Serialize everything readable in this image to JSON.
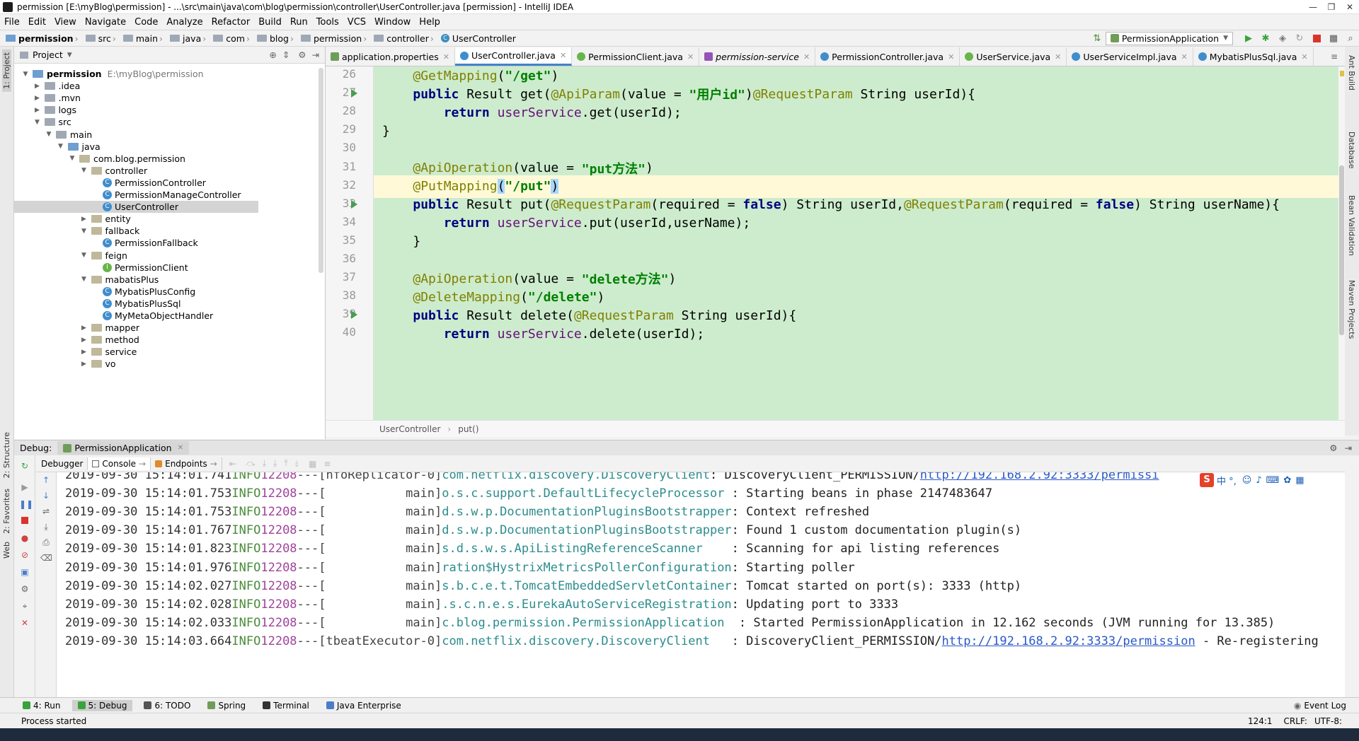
{
  "window": {
    "title": "permission [E:\\myBlog\\permission] - ...\\src\\main\\java\\com\\blog\\permission\\controller\\UserController.java [permission] - IntelliJ IDEA",
    "min": "—",
    "max": "❐",
    "close": "✕"
  },
  "menu": [
    "File",
    "Edit",
    "View",
    "Navigate",
    "Code",
    "Analyze",
    "Refactor",
    "Build",
    "Run",
    "Tools",
    "VCS",
    "Window",
    "Help"
  ],
  "breadcrumb": [
    "permission",
    "src",
    "main",
    "java",
    "com",
    "blog",
    "permission",
    "controller",
    "UserController"
  ],
  "run_config": "PermissionApplication",
  "project_panel": {
    "title": "Project",
    "items": [
      {
        "label": "permission",
        "path": "E:\\myBlog\\permission",
        "indent": 0,
        "expanded": true,
        "kind": "folder-blue"
      },
      {
        "label": ".idea",
        "indent": 1,
        "expanded": false,
        "kind": "folder"
      },
      {
        "label": ".mvn",
        "indent": 1,
        "expanded": false,
        "kind": "folder"
      },
      {
        "label": "logs",
        "indent": 1,
        "expanded": false,
        "kind": "folder"
      },
      {
        "label": "src",
        "indent": 1,
        "expanded": true,
        "kind": "folder"
      },
      {
        "label": "main",
        "indent": 2,
        "expanded": true,
        "kind": "folder"
      },
      {
        "label": "java",
        "indent": 3,
        "expanded": true,
        "kind": "folder-blue"
      },
      {
        "label": "com.blog.permission",
        "indent": 4,
        "expanded": true,
        "kind": "pkg"
      },
      {
        "label": "controller",
        "indent": 5,
        "expanded": true,
        "kind": "pkg"
      },
      {
        "label": "PermissionController",
        "indent": 6,
        "kind": "class"
      },
      {
        "label": "PermissionManageController",
        "indent": 6,
        "kind": "class"
      },
      {
        "label": "UserController",
        "indent": 6,
        "kind": "class",
        "selected": true
      },
      {
        "label": "entity",
        "indent": 5,
        "expanded": false,
        "kind": "pkg"
      },
      {
        "label": "fallback",
        "indent": 5,
        "expanded": true,
        "kind": "pkg"
      },
      {
        "label": "PermissionFallback",
        "indent": 6,
        "kind": "class"
      },
      {
        "label": "feign",
        "indent": 5,
        "expanded": true,
        "kind": "pkg"
      },
      {
        "label": "PermissionClient",
        "indent": 6,
        "kind": "interface"
      },
      {
        "label": "mabatisPlus",
        "indent": 5,
        "expanded": true,
        "kind": "pkg"
      },
      {
        "label": "MybatisPlusConfig",
        "indent": 6,
        "kind": "class"
      },
      {
        "label": "MybatisPlusSql",
        "indent": 6,
        "kind": "class"
      },
      {
        "label": "MyMetaObjectHandler",
        "indent": 6,
        "kind": "class"
      },
      {
        "label": "mapper",
        "indent": 5,
        "expanded": false,
        "kind": "pkg"
      },
      {
        "label": "method",
        "indent": 5,
        "expanded": false,
        "kind": "pkg"
      },
      {
        "label": "service",
        "indent": 5,
        "expanded": false,
        "kind": "pkg"
      },
      {
        "label": "vo",
        "indent": 5,
        "expanded": false,
        "kind": "pkg"
      }
    ]
  },
  "editor_tabs": [
    {
      "label": "application.properties",
      "icon": "p"
    },
    {
      "label": "UserController.java",
      "icon": "c",
      "active": true
    },
    {
      "label": "PermissionClient.java",
      "icon": "i"
    },
    {
      "label": "permission-service",
      "icon": "m"
    },
    {
      "label": "PermissionController.java",
      "icon": "c"
    },
    {
      "label": "UserService.java",
      "icon": "i"
    },
    {
      "label": "UserServiceImpl.java",
      "icon": "c"
    },
    {
      "label": "MybatisPlusSql.java",
      "icon": "c"
    }
  ],
  "code_lines": [
    {
      "n": "26",
      "segs": [
        [
          "    ",
          "plain"
        ],
        [
          "@GetMapping",
          "ann"
        ],
        [
          "(",
          "plain"
        ],
        [
          "\"/get\"",
          "str"
        ],
        [
          ")",
          "plain"
        ]
      ]
    },
    {
      "n": "27",
      "run": true,
      "segs": [
        [
          "    ",
          "plain"
        ],
        [
          "public ",
          "kw"
        ],
        [
          "Result get(",
          "plain"
        ],
        [
          "@ApiParam",
          "ann"
        ],
        [
          "(value = ",
          "plain"
        ],
        [
          "\"用户id\"",
          "str"
        ],
        [
          ")",
          "plain"
        ],
        [
          "@RequestParam",
          "ann"
        ],
        [
          " String userId){",
          "plain"
        ]
      ]
    },
    {
      "n": "28",
      "segs": [
        [
          "        ",
          "plain"
        ],
        [
          "return ",
          "kw"
        ],
        [
          "userService",
          "fld"
        ],
        [
          ".get(userId);",
          "plain"
        ]
      ]
    },
    {
      "n": "29",
      "segs": [
        [
          "}",
          "plain"
        ]
      ]
    },
    {
      "n": "30",
      "segs": [
        [
          "",
          "plain"
        ]
      ]
    },
    {
      "n": "31",
      "segs": [
        [
          "    ",
          "plain"
        ],
        [
          "@ApiOperation",
          "ann"
        ],
        [
          "(value = ",
          "plain"
        ],
        [
          "\"put方法\"",
          "str"
        ],
        [
          ")",
          "plain"
        ]
      ]
    },
    {
      "n": "32",
      "current": true,
      "segs": [
        [
          "    ",
          "plain"
        ],
        [
          "@PutMapping",
          "ann"
        ],
        [
          "(",
          "hl"
        ],
        [
          "\"/put\"",
          "str"
        ],
        [
          ")",
          "hl"
        ]
      ]
    },
    {
      "n": "33",
      "run": true,
      "segs": [
        [
          "    ",
          "plain"
        ],
        [
          "public ",
          "kw"
        ],
        [
          "Result put(",
          "plain"
        ],
        [
          "@RequestParam",
          "ann"
        ],
        [
          "(required = ",
          "plain"
        ],
        [
          "false",
          "kw"
        ],
        [
          ") String userId,",
          "plain"
        ],
        [
          "@RequestParam",
          "ann"
        ],
        [
          "(required = ",
          "plain"
        ],
        [
          "false",
          "kw"
        ],
        [
          ") String userName){",
          "plain"
        ]
      ]
    },
    {
      "n": "34",
      "segs": [
        [
          "        ",
          "plain"
        ],
        [
          "return ",
          "kw"
        ],
        [
          "userService",
          "fld"
        ],
        [
          ".put(userId,userName);",
          "plain"
        ]
      ]
    },
    {
      "n": "35",
      "segs": [
        [
          "    }",
          "plain"
        ]
      ]
    },
    {
      "n": "36",
      "segs": [
        [
          "",
          "plain"
        ]
      ]
    },
    {
      "n": "37",
      "segs": [
        [
          "    ",
          "plain"
        ],
        [
          "@ApiOperation",
          "ann"
        ],
        [
          "(value = ",
          "plain"
        ],
        [
          "\"delete方法\"",
          "str"
        ],
        [
          ")",
          "plain"
        ]
      ]
    },
    {
      "n": "38",
      "segs": [
        [
          "    ",
          "plain"
        ],
        [
          "@DeleteMapping",
          "ann"
        ],
        [
          "(",
          "plain"
        ],
        [
          "\"/delete\"",
          "str"
        ],
        [
          ")",
          "plain"
        ]
      ]
    },
    {
      "n": "39",
      "run": true,
      "segs": [
        [
          "    ",
          "plain"
        ],
        [
          "public ",
          "kw"
        ],
        [
          "Result delete(",
          "plain"
        ],
        [
          "@RequestParam",
          "ann"
        ],
        [
          " String userId){",
          "plain"
        ]
      ]
    },
    {
      "n": "40",
      "segs": [
        [
          "        ",
          "plain"
        ],
        [
          "return ",
          "kw"
        ],
        [
          "userService",
          "fld"
        ],
        [
          ".delete(userId);",
          "plain"
        ]
      ]
    }
  ],
  "editor_breadcrumb": [
    "UserController",
    "put()"
  ],
  "debug": {
    "label": "Debug:",
    "config_tab": "PermissionApplication",
    "tabs": [
      "Debugger",
      "Console",
      "Endpoints"
    ]
  },
  "console_lines": [
    {
      "time": "2019-09-30 15:14:01.741",
      "level": "INFO",
      "pid": "12208",
      "sep": "---",
      "thread": "[nfoReplicator-0]",
      "logger": "com.netflix.discovery.DiscoveryClient",
      "msg": ": DiscoveryClient_PERMISSION/",
      "link": "http://192.168.2.92:3333/permissi"
    },
    {
      "time": "2019-09-30 15:14:01.753",
      "level": "INFO",
      "pid": "12208",
      "sep": "---",
      "thread": "[           main]",
      "logger": "o.s.c.support.DefaultLifecycleProcessor ",
      "msg": ": Starting beans in phase 2147483647"
    },
    {
      "time": "2019-09-30 15:14:01.753",
      "level": "INFO",
      "pid": "12208",
      "sep": "---",
      "thread": "[           main]",
      "logger": "d.s.w.p.DocumentationPluginsBootstrapper",
      "msg": ": Context refreshed"
    },
    {
      "time": "2019-09-30 15:14:01.767",
      "level": "INFO",
      "pid": "12208",
      "sep": "---",
      "thread": "[           main]",
      "logger": "d.s.w.p.DocumentationPluginsBootstrapper",
      "msg": ": Found 1 custom documentation plugin(s)"
    },
    {
      "time": "2019-09-30 15:14:01.823",
      "level": "INFO",
      "pid": "12208",
      "sep": "---",
      "thread": "[           main]",
      "logger": "s.d.s.w.s.ApiListingReferenceScanner    ",
      "msg": ": Scanning for api listing references"
    },
    {
      "time": "2019-09-30 15:14:01.976",
      "level": "INFO",
      "pid": "12208",
      "sep": "---",
      "thread": "[           main]",
      "logger": "ration$HystrixMetricsPollerConfiguration",
      "msg": ": Starting poller"
    },
    {
      "time": "2019-09-30 15:14:02.027",
      "level": "INFO",
      "pid": "12208",
      "sep": "---",
      "thread": "[           main]",
      "logger": "s.b.c.e.t.TomcatEmbeddedServletContainer",
      "msg": ": Tomcat started on port(s): 3333 (http)"
    },
    {
      "time": "2019-09-30 15:14:02.028",
      "level": "INFO",
      "pid": "12208",
      "sep": "---",
      "thread": "[           main]",
      "logger": ".s.c.n.e.s.EurekaAutoServiceRegistration",
      "msg": ": Updating port to 3333"
    },
    {
      "time": "2019-09-30 15:14:02.033",
      "level": "INFO",
      "pid": "12208",
      "sep": "---",
      "thread": "[           main]",
      "logger": "c.blog.permission.PermissionApplication  ",
      "msg": ": Started PermissionApplication in 12.162 seconds (JVM running for 13.385)"
    },
    {
      "time": "2019-09-30 15:14:03.664",
      "level": "INFO",
      "pid": "12208",
      "sep": "---",
      "thread": "[tbeatExecutor-0]",
      "logger": "com.netflix.discovery.DiscoveryClient   ",
      "msg": ": DiscoveryClient_PERMISSION/",
      "link": "http://192.168.2.92:3333/permission",
      "tail": " - Re-registering"
    }
  ],
  "ime": "中 °,",
  "bottom_tools": [
    {
      "label": "4: Run"
    },
    {
      "label": "5: Debug",
      "active": true
    },
    {
      "label": "6: TODO"
    },
    {
      "label": "Spring"
    },
    {
      "label": "Terminal"
    },
    {
      "label": "Java Enterprise"
    }
  ],
  "event_log": "Event Log",
  "status": {
    "message": "Process started",
    "position": "124:1",
    "line_sep": "CRLF:",
    "encoding": "UTF-8:"
  },
  "left_strip": [
    "1: Project",
    "2: Structure",
    "2: Favorites",
    "Web"
  ],
  "right_strip": [
    "Ant Build",
    "Database",
    "Bean Validation",
    "Maven Projects"
  ],
  "colors": {
    "code_bg": "#cdeccd",
    "current_line": "#fff9d7",
    "annotation": "#808000",
    "keyword": "#000080",
    "string": "#008000"
  }
}
